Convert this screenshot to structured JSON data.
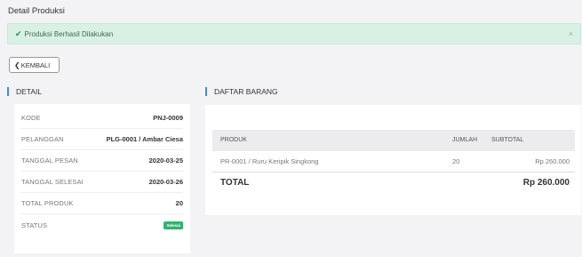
{
  "page": {
    "title": "Detail Produksi"
  },
  "alert": {
    "message": "Produksi Berhasil Dilakukan",
    "close": "×"
  },
  "back_button": {
    "label": "KEMBALI"
  },
  "detail": {
    "title": "DETAIL",
    "rows": [
      {
        "label": "KODE",
        "value": "PNJ-0009"
      },
      {
        "label": "PELANGGAN",
        "value": "PLG-0001 / Ambar Ciesa"
      },
      {
        "label": "TANGGAL PESAN",
        "value": "2020-03-25"
      },
      {
        "label": "TANGGAL SELESAI",
        "value": "2020-03-26"
      },
      {
        "label": "TOTAL PRODUK",
        "value": "20"
      },
      {
        "label": "STATUS",
        "badge": "Selesai"
      }
    ]
  },
  "barang": {
    "title": "DAFTAR BARANG",
    "columns": [
      "PRODUK",
      "JUMLAH",
      "SUBTOTAL"
    ],
    "rows": [
      {
        "produk": "PR-0001 / Ruru Keripik Singkong",
        "jumlah": "20",
        "subtotal": "Rp 260.000"
      }
    ],
    "total_label": "TOTAL",
    "total_value": "Rp 260.000"
  },
  "colors": {
    "accent": "#3a8ee6",
    "success_bg": "#d8f1e4",
    "badge": "#2fb36e"
  },
  "icons": {
    "alert": "check-icon",
    "back": "chevron-left-icon"
  }
}
